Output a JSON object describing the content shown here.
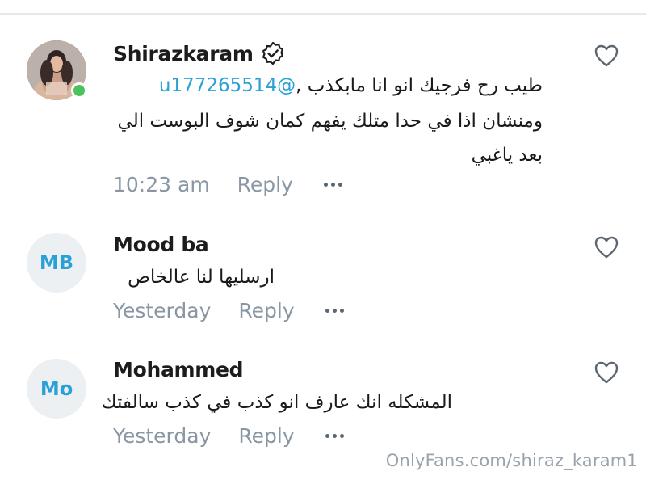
{
  "comments": [
    {
      "author": "Shirazkaram",
      "verified": true,
      "online": true,
      "avatar_type": "photo",
      "mention": "@u177265514",
      "line1_text": " طيب رح فرجيك انو انا مابكذب ,",
      "line2": "ومنشان اذا في حدا متلك يفهم كمان شوف البوست الي",
      "line3": "بعد ياغبي",
      "time": "10:23 am",
      "reply_label": "Reply"
    },
    {
      "author": "Mood ba",
      "verified": false,
      "online": false,
      "avatar_type": "initials",
      "initials": "MB",
      "line1": "ارسليها لنا عالخاص",
      "time": "Yesterday",
      "reply_label": "Reply"
    },
    {
      "author": "Mohammed",
      "verified": false,
      "online": false,
      "avatar_type": "initials",
      "initials": "Mo",
      "line1": "المشكله انك عارف انو كذب في كذب سالفتك",
      "time": "Yesterday",
      "reply_label": "Reply"
    }
  ],
  "watermark": "OnlyFans.com/shiraz_karam1",
  "colors": {
    "accent": "#2aa1d6",
    "meta_text": "#8a96a3",
    "online": "#4cc35a",
    "avatar_bg": "#edf0f2"
  },
  "icons": {
    "like": "heart-outline-icon",
    "verified": "verified-badge-icon",
    "more": "more-dots-icon"
  }
}
